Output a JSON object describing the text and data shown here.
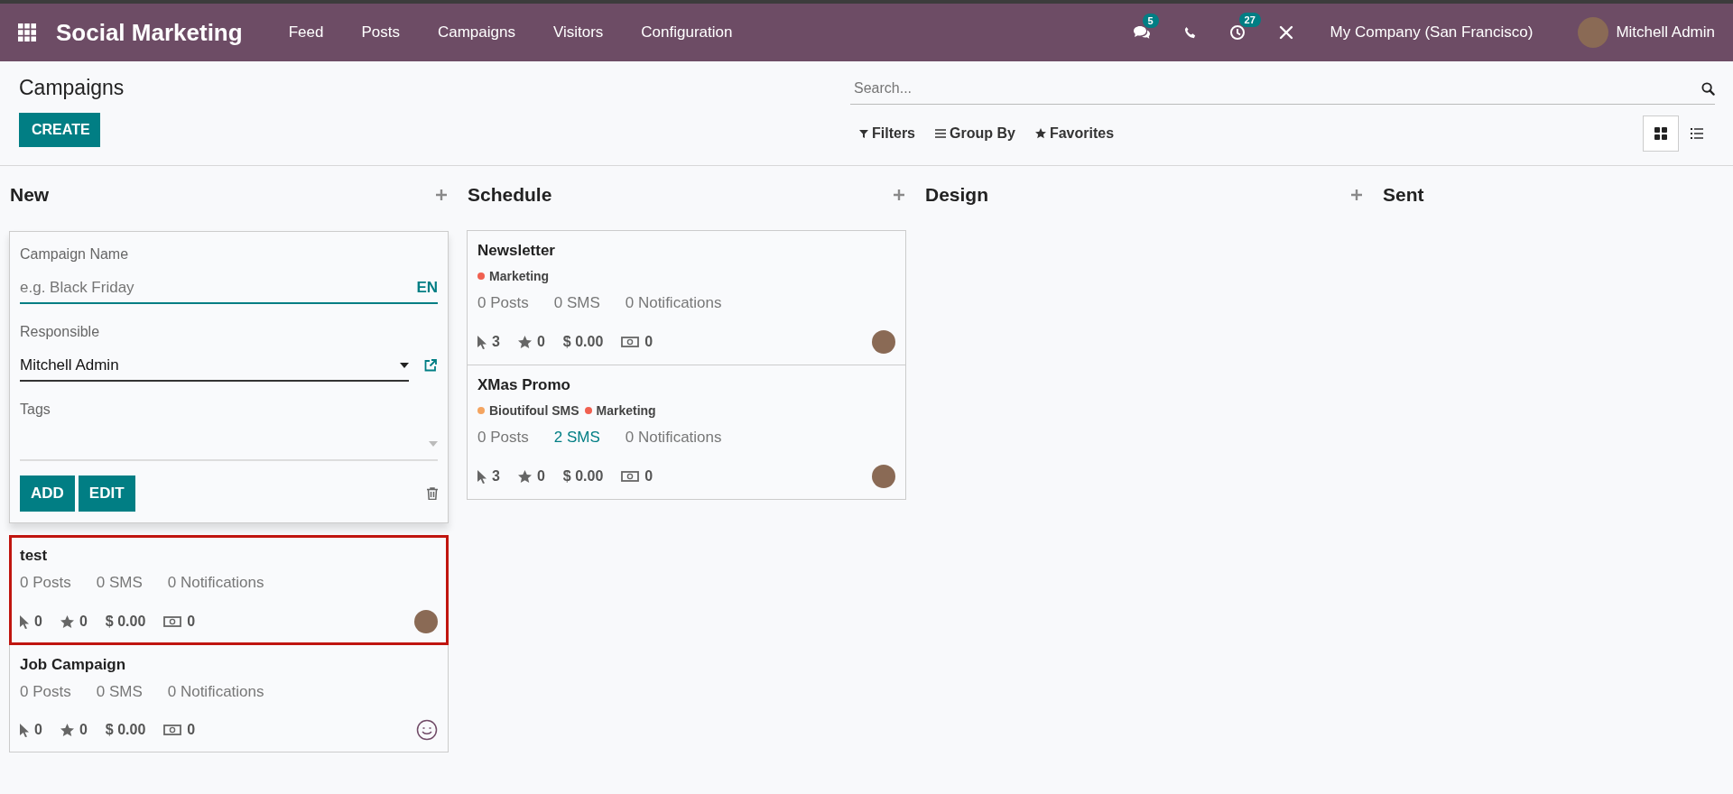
{
  "navbar": {
    "app_name": "Social Marketing",
    "menu": [
      {
        "label": "Feed"
      },
      {
        "label": "Posts"
      },
      {
        "label": "Campaigns"
      },
      {
        "label": "Visitors"
      },
      {
        "label": "Configuration"
      }
    ],
    "messages_badge": "5",
    "activities_badge": "27",
    "company": "My Company (San Francisco)",
    "user": "Mitchell Admin"
  },
  "control_panel": {
    "title": "Campaigns",
    "create_button": "CREATE",
    "search": {
      "placeholder": "Search..."
    },
    "filters": [
      {
        "kind": "filter",
        "label": "Filters"
      },
      {
        "kind": "group",
        "label": "Group By"
      },
      {
        "kind": "favorite",
        "label": "Favorites"
      }
    ],
    "views": [
      {
        "kind": "kanban",
        "selected": true
      },
      {
        "kind": "list",
        "selected": false
      }
    ]
  },
  "columns": [
    {
      "title": "New",
      "add": true,
      "quick_create": {
        "name_label": "Campaign Name",
        "name_placeholder": "e.g. Black Friday",
        "lang": "EN",
        "responsible_label": "Responsible",
        "responsible_value": "Mitchell Admin",
        "tags_label": "Tags",
        "buttons": [
          "ADD",
          "EDIT"
        ]
      },
      "cards": [
        {
          "title": "test",
          "selected": true,
          "stats": [
            {
              "text": "0 Posts",
              "highlighted": false
            },
            {
              "text": "0 SMS",
              "highlighted": false
            },
            {
              "text": "0 Notifications",
              "highlighted": false
            }
          ],
          "clicks": "0",
          "rating": "0",
          "revenue": "$ 0.00",
          "payments": "0",
          "avatar_photo": true
        },
        {
          "title": "Job Campaign",
          "selected": false,
          "stats": [
            {
              "text": "0 Posts",
              "highlighted": false
            },
            {
              "text": "0 SMS",
              "highlighted": false
            },
            {
              "text": "0 Notifications",
              "highlighted": false
            }
          ],
          "clicks": "0",
          "rating": "0",
          "revenue": "$ 0.00",
          "payments": "0",
          "avatar_photo": false
        }
      ]
    },
    {
      "title": "Schedule",
      "add": true,
      "cards": [
        {
          "title": "Newsletter",
          "selected": false,
          "tags": [
            {
              "label": "Marketing",
              "color": "#f06050"
            }
          ],
          "stats": [
            {
              "text": "0 Posts",
              "highlighted": false
            },
            {
              "text": "0 SMS",
              "highlighted": false
            },
            {
              "text": "0 Notifications",
              "highlighted": false
            }
          ],
          "clicks": "3",
          "rating": "0",
          "revenue": "$ 0.00",
          "payments": "0",
          "avatar_photo": true
        },
        {
          "title": "XMas Promo",
          "selected": false,
          "tags": [
            {
              "label": "Bioutifoul SMS",
              "color": "#f4a460"
            },
            {
              "label": "Marketing",
              "color": "#f06050"
            }
          ],
          "stats": [
            {
              "text": "0 Posts",
              "highlighted": false
            },
            {
              "text": "2 SMS",
              "highlighted": true
            },
            {
              "text": "0 Notifications",
              "highlighted": false
            }
          ],
          "clicks": "3",
          "rating": "0",
          "revenue": "$ 0.00",
          "payments": "0",
          "avatar_photo": true
        }
      ]
    },
    {
      "title": "Design",
      "add": true
    },
    {
      "title": "Sent",
      "add": false
    }
  ]
}
